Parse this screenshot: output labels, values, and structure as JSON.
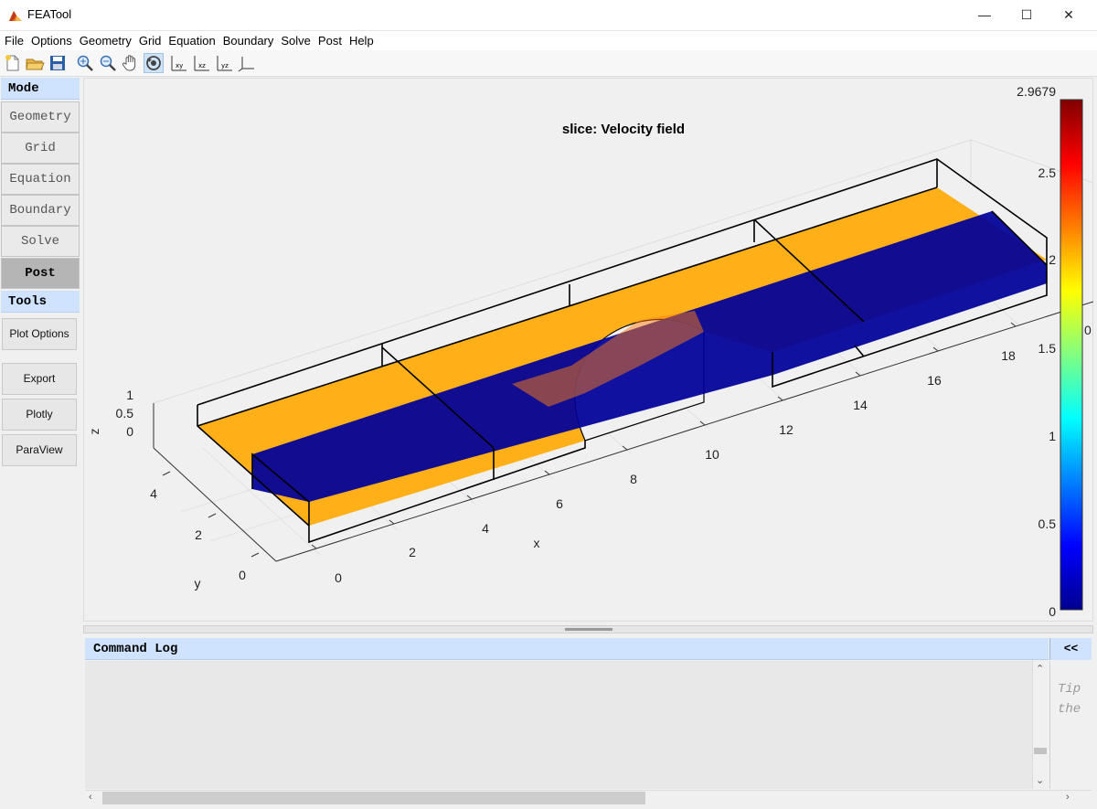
{
  "window": {
    "title": "FEATool",
    "minimize": "—",
    "maximize": "☐",
    "close": "✕"
  },
  "menu": [
    "File",
    "Options",
    "Geometry",
    "Grid",
    "Equation",
    "Boundary",
    "Solve",
    "Post",
    "Help"
  ],
  "toolbar": {
    "icons": [
      "new-file-icon",
      "open-folder-icon",
      "save-icon",
      "zoom-in-icon",
      "zoom-out-icon",
      "pan-hand-icon",
      "rotate-3d-icon",
      "view-xy-icon",
      "view-xz-icon",
      "view-yz-icon",
      "view-3d-axes-icon"
    ],
    "view_labels": {
      "xy": "xy",
      "xz": "xz",
      "yz": "yz"
    }
  },
  "sidebar": {
    "mode_header": "Mode",
    "modes": [
      "Geometry",
      "Grid",
      "Equation",
      "Boundary",
      "Solve",
      "Post"
    ],
    "active_mode": "Post",
    "tools_header": "Tools",
    "tools": [
      "Plot Options",
      "Export",
      "Plotly",
      "ParaView"
    ]
  },
  "plot": {
    "title": "slice: Velocity field",
    "axes": {
      "x": "x",
      "y": "y",
      "z": "z"
    },
    "colorbar": {
      "max_label": "2.9679",
      "ticks": [
        "2.5",
        "2",
        "1.5",
        "1",
        "0.5",
        "0"
      ],
      "clipped_label": "0"
    }
  },
  "chart_data": {
    "type": "heatmap",
    "title": "slice: Velocity field",
    "xlabel": "x",
    "ylabel": "y",
    "zlabel": "z",
    "x_ticks": [
      "0",
      "2",
      "4",
      "6",
      "8",
      "10",
      "12",
      "14",
      "16",
      "18"
    ],
    "y_ticks": [
      "0",
      "2",
      "4"
    ],
    "z_ticks": [
      "0",
      "0.5",
      "1"
    ],
    "colorbar_range": [
      0,
      2.9679
    ],
    "colorbar_ticks": [
      0,
      0.5,
      1,
      1.5,
      2,
      2.5
    ],
    "colormap": "jet"
  },
  "log": {
    "header": "Command Log",
    "collapse_label": "<<",
    "tip_lines": [
      "Tip",
      "the"
    ]
  }
}
